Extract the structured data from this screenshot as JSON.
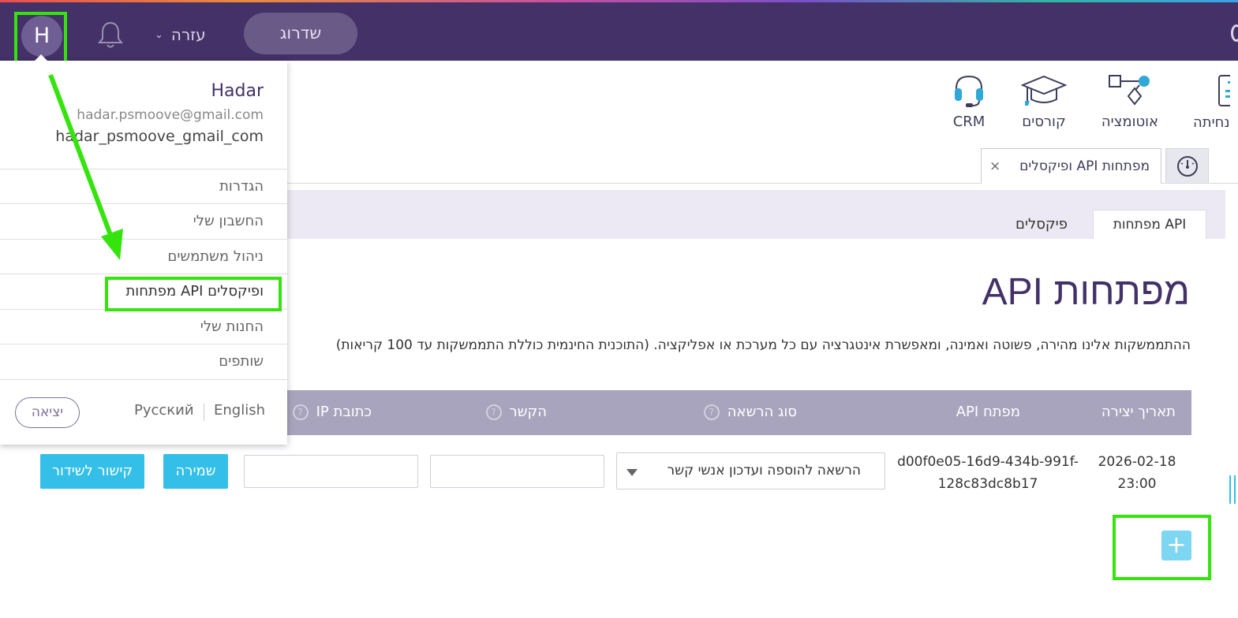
{
  "topbar": {
    "avatar_letter": "H",
    "help_label": "עזרה",
    "upgrade_label": "שדרוג"
  },
  "apps": [
    {
      "label": "נחיתה",
      "icon": "landing-page-icon"
    },
    {
      "label": "אוטומציה",
      "icon": "automation-icon"
    },
    {
      "label": "קורסים",
      "icon": "graduation-cap-icon"
    },
    {
      "label": "CRM",
      "icon": "headset-icon"
    }
  ],
  "tabs": {
    "open_tab_label": "מפתחות API ופיקסלים",
    "close_symbol": "×"
  },
  "subtabs": {
    "api_keys": "מפתחות API",
    "pixels": "פיקסלים"
  },
  "main": {
    "title": "מפתחות API",
    "description": "ההתממשקות אלינו מהירה, פשוטה ואמינה, ומאפשרת אינטגרציה עם כל מערכת או אפליקציה. (התוכנית החינמית כוללת התממשקות עד 100 קריאות)"
  },
  "table": {
    "headers": {
      "created": "תאריך יצירה",
      "api_key": "מפתח API",
      "permission": "סוג הרשאה",
      "link": "הקשר",
      "ip": "כתובת IP"
    },
    "help_symbol": "?",
    "row": {
      "date_line1": "2026-02-18",
      "date_line2": "23:00",
      "key_line1": "d00f0e05-16d9-434b-991f-",
      "key_line2": "128c83dc8b17",
      "permission_value": "הרשאה להוספה ועדכון אנשי קשר",
      "link_value": "",
      "ip_value": "",
      "save_label": "שמירה",
      "broadcast_label": "קישור לשידור"
    },
    "add_symbol": "+"
  },
  "dropdown": {
    "name": "Hadar",
    "email": "hadar.psmoove@gmail.com",
    "username": "hadar_psmoove_gmail_com",
    "items": [
      {
        "label": "הגדרות"
      },
      {
        "label": "החשבון שלי"
      },
      {
        "label": "ניהול משתמשים"
      },
      {
        "label": "מפתחות API ופיקסלים"
      },
      {
        "label": "החנות שלי"
      },
      {
        "label": "שותפים"
      }
    ],
    "lang_en": "English",
    "lang_ru": "Русский",
    "logout_label": "יציאה"
  },
  "colors": {
    "topbar": "#433167",
    "accent": "#33bfe7",
    "highlight": "#35e40d",
    "table_header": "#a9a4bd"
  }
}
